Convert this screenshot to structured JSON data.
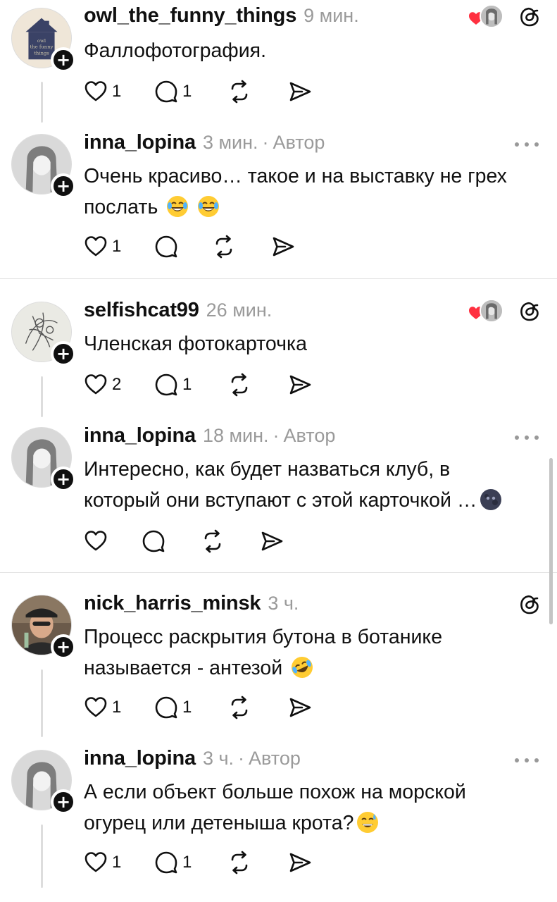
{
  "comments": [
    {
      "username": "owl_the_funny_things",
      "time": "9 мин.",
      "author_label": "",
      "text_lines": [
        "Фаллофотография."
      ],
      "likes": "1",
      "replies": "1",
      "avatar_text": [
        "owl",
        "the funny",
        "things"
      ]
    },
    {
      "username": "inna_lopina",
      "time": "3 мин.",
      "author_label": "Автор",
      "text_lines": [
        "Очень красиво… такое и на выставку не грех",
        "послать"
      ],
      "emojis": [
        "tears-of-joy-emoji",
        "tears-of-joy-emoji"
      ],
      "likes": "1",
      "replies": ""
    },
    {
      "username": "selfishcat99",
      "time": "26 мин.",
      "author_label": "",
      "text_lines": [
        "Членская фотокарточка"
      ],
      "likes": "2",
      "replies": "1"
    },
    {
      "username": "inna_lopina",
      "time": "18 мин.",
      "author_label": "Автор",
      "text_lines": [
        "Интересно, как будет назваться клуб, в",
        "который они вступают с этой карточкой …"
      ],
      "emojis": [
        "new-moon-face-emoji"
      ],
      "likes": "",
      "replies": ""
    },
    {
      "username": "nick_harris_minsk",
      "time": "3 ч.",
      "author_label": "",
      "text_lines": [
        "Процесс раскрытия бутона в ботанике",
        "называется - антезой"
      ],
      "emojis": [
        "rolling-on-floor-laughing-emoji"
      ],
      "likes": "1",
      "replies": "1"
    },
    {
      "username": "inna_lopina",
      "time": "3 ч.",
      "author_label": "Автор",
      "text_lines": [
        "А если объект больше похож на морской",
        "огурец или детеныша крота?"
      ],
      "emojis": [
        "grinning-sweat-emoji"
      ],
      "likes": "1",
      "replies": "1"
    }
  ],
  "colors": {
    "text": "#101010",
    "muted": "#9a9a9a",
    "heart": "#ff3040",
    "divider": "#e3e3e3"
  },
  "icons": [
    "heart-icon",
    "comment-icon",
    "repost-icon",
    "share-icon",
    "threads-icon",
    "more-icon",
    "follow-plus-icon"
  ]
}
